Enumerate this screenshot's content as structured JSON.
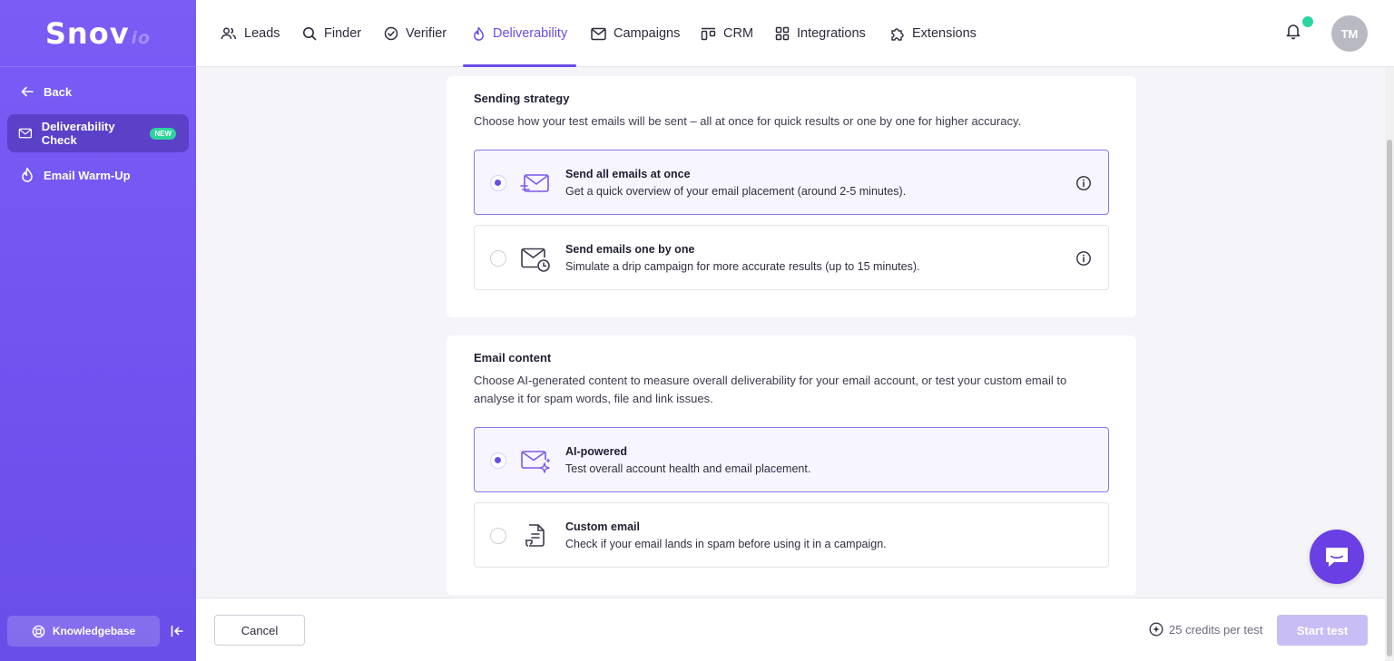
{
  "brand": {
    "name": "Snov",
    "suffix": "io"
  },
  "sidebar": {
    "back_label": "Back",
    "items": [
      {
        "label": "Deliverability Check",
        "badge": "NEW",
        "icon": "envelope-check-icon"
      },
      {
        "label": "Email Warm-Up",
        "icon": "flame-icon"
      }
    ],
    "knowledgebase_label": "Knowledgebase"
  },
  "topnav": {
    "items": [
      {
        "label": "Leads",
        "icon": "users-icon"
      },
      {
        "label": "Finder",
        "icon": "search-icon"
      },
      {
        "label": "Verifier",
        "icon": "check-circle-icon"
      },
      {
        "label": "Deliverability",
        "icon": "flame-icon",
        "active": true
      },
      {
        "label": "Campaigns",
        "icon": "envelope-icon"
      },
      {
        "label": "CRM",
        "icon": "crm-icon"
      },
      {
        "label": "Integrations",
        "icon": "grid-icon"
      },
      {
        "label": "Extensions",
        "icon": "puzzle-icon"
      }
    ],
    "avatar_initials": "TM"
  },
  "sending_strategy": {
    "title": "Sending strategy",
    "description": "Choose how your test emails will be sent – all at once for quick results or one by one for higher accuracy.",
    "options": [
      {
        "title": "Send all emails at once",
        "description": "Get a quick overview of your email placement (around 2-5 minutes).",
        "selected": true
      },
      {
        "title": "Send emails one by one",
        "description": "Simulate a drip campaign for more accurate results (up to 15 minutes).",
        "selected": false
      }
    ]
  },
  "email_content": {
    "title": "Email content",
    "description": "Choose AI-generated content to measure overall deliverability for your email account, or test your custom email to analyse it for spam words, file and link issues.",
    "options": [
      {
        "title": "AI-powered",
        "description": "Test overall account health and email placement.",
        "selected": true
      },
      {
        "title": "Custom email",
        "description": "Check if your email lands in spam before using it in a campaign.",
        "selected": false
      }
    ]
  },
  "footer": {
    "cancel_label": "Cancel",
    "credits_text": "25 credits per test",
    "start_label": "Start test"
  },
  "colors": {
    "accent": "#6b4de6",
    "sidebar": "#7357f0",
    "notification_dot": "#2ad5a0",
    "new_badge": "#2bd49b"
  }
}
